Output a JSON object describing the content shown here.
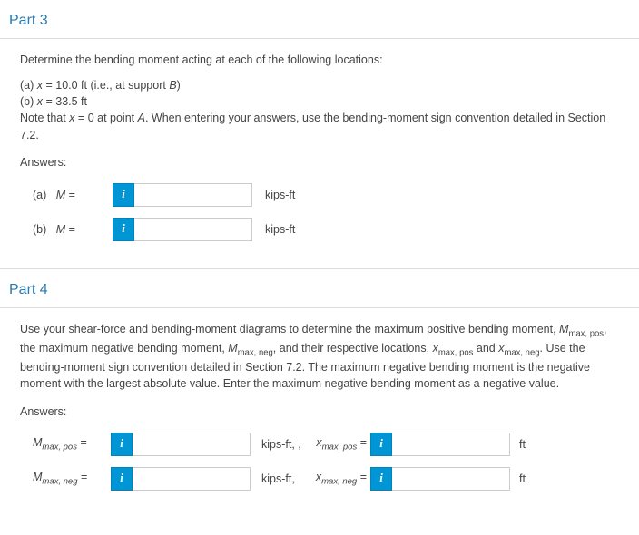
{
  "part3": {
    "title": "Part 3",
    "prompt": "Determine the bending moment acting at each of the following locations:",
    "line_a_prefix": "(a) ",
    "line_a_var": "x",
    "line_a_eq": " = 10.0 ft (i.e., at support ",
    "line_a_sup": "B",
    "line_a_close": ")",
    "line_b_prefix": "(b) ",
    "line_b_var": "x",
    "line_b_rest": " = 33.5 ft",
    "note_prefix": "Note that ",
    "note_var": "x",
    "note_mid": " = 0 at point ",
    "note_pt": "A",
    "note_rest": ".  When entering your answers, use the bending-moment sign convention detailed in Section 7.2.",
    "answers_label": "Answers:",
    "row_a": {
      "prefix": "(a)",
      "var": "M",
      "eq": " = ",
      "unit": "kips-ft"
    },
    "row_b": {
      "prefix": "(b)",
      "var": "M",
      "eq": " = ",
      "unit": "kips-ft"
    }
  },
  "part4": {
    "title": "Part 4",
    "p_t1": "Use your shear-force and bending-moment diagrams to determine the maximum positive bending moment, ",
    "p_v1": "M",
    "p_s1": "max, pos",
    "p_t2": ", the maximum negative bending moment, ",
    "p_v2": "M",
    "p_s2": "max, neg",
    "p_t3": ", and their respective locations, ",
    "p_v3": "x",
    "p_s3": "max, pos",
    "p_t4": " and ",
    "p_v4": "x",
    "p_s4": "max, neg",
    "p_t5": ". Use the bending-moment sign convention detailed in Section 7.2. The maximum negative bending moment is the negative moment with the largest absolute value. Enter the maximum negative bending moment as a negative value.",
    "answers_label": "Answers:",
    "row1": {
      "v1": "M",
      "s1": "max, pos",
      "eq": " = ",
      "u1": "kips-ft, ,",
      "v2": "x",
      "s2": "max, pos",
      "eq2": " = ",
      "u2": "ft"
    },
    "row2": {
      "v1": "M",
      "s1": "max, neg",
      "eq": " = ",
      "u1": "kips-ft,",
      "v2": "x",
      "s2": "max, neg",
      "eq2": " = ",
      "u2": "ft"
    }
  },
  "info_glyph": "i"
}
